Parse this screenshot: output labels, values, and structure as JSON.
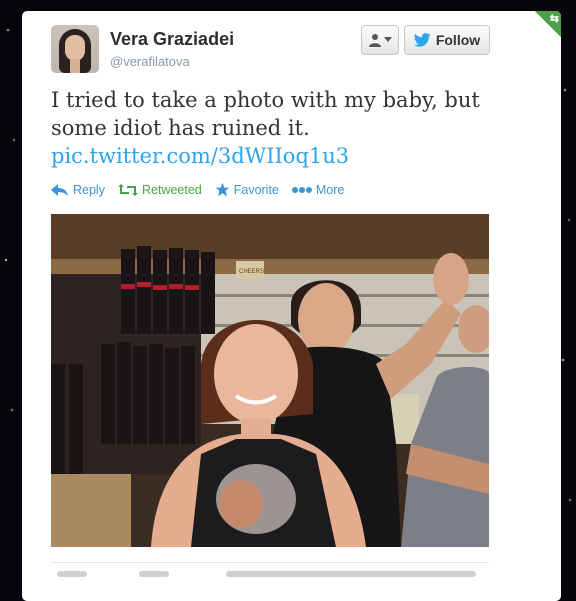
{
  "tweet": {
    "author_name": "Vera Graziadei",
    "author_handle": "@verafilatova",
    "text": "I tried to take a photo with my baby, but some idiot has ruined it.",
    "link": "pic.twitter.com/3dWIIoq1u3",
    "follow_label": "Follow",
    "actions": {
      "reply": "Reply",
      "retweeted": "Retweeted",
      "favorite": "Favorite",
      "more": "More"
    }
  },
  "photo": {
    "description_icon": "embedded-photo",
    "sign_text": "CHEERS"
  },
  "colors": {
    "link_blue": "#2fa3ed",
    "retweet_green": "#4aa34a",
    "action_blue": "#3b94d9",
    "text_dark": "#333333",
    "muted": "#8899a6"
  }
}
